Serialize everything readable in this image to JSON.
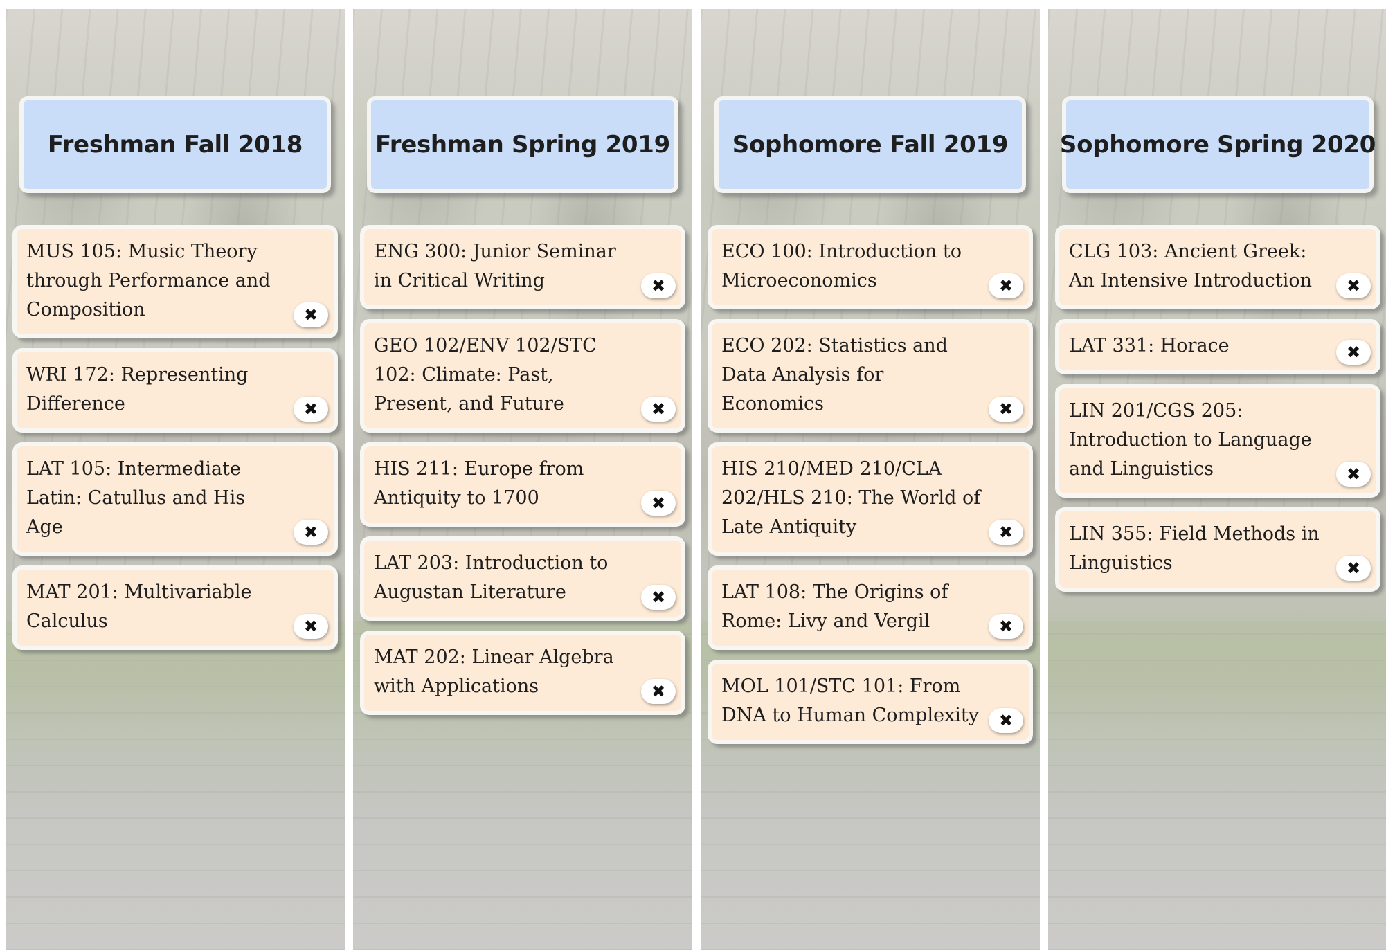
{
  "semesters": [
    {
      "title": "Freshman Fall 2018",
      "courses": [
        {
          "title": "MUS 105: Music Theory through Performance and Composition"
        },
        {
          "title": "WRI 172: Representing Difference"
        },
        {
          "title": "LAT 105: Intermediate Latin: Catullus and His Age"
        },
        {
          "title": "MAT 201: Multivariable Calculus"
        }
      ]
    },
    {
      "title": "Freshman Spring 2019",
      "courses": [
        {
          "title": "ENG 300: Junior Seminar in Critical Writing"
        },
        {
          "title": "GEO 102/ENV 102/STC 102: Climate: Past, Present, and Future"
        },
        {
          "title": "HIS 211: Europe from Antiquity to 1700"
        },
        {
          "title": "LAT 203: Introduction to Augustan Literature"
        },
        {
          "title": "MAT 202: Linear Algebra with Applications"
        }
      ]
    },
    {
      "title": "Sophomore Fall 2019",
      "courses": [
        {
          "title": "ECO 100: Introduction to Microeconomics"
        },
        {
          "title": "ECO 202: Statistics and Data Analysis for Economics"
        },
        {
          "title": "HIS 210/MED 210/CLA 202/HLS 210: The World of Late Antiquity"
        },
        {
          "title": "LAT 108: The Origins of Rome: Livy and Vergil"
        },
        {
          "title": "MOL 101/STC 101: From DNA to Human Complexity"
        }
      ]
    },
    {
      "title": "Sophomore Spring 2020",
      "courses": [
        {
          "title": "CLG 103: Ancient Greek: An Intensive Introduction"
        },
        {
          "title": "LAT 331: Horace"
        },
        {
          "title": "LIN 201/CGS 205: Introduction to Language and Linguistics"
        },
        {
          "title": "LIN 355: Field Methods in Linguistics"
        }
      ]
    }
  ],
  "remove_icon_glyph": "✖"
}
